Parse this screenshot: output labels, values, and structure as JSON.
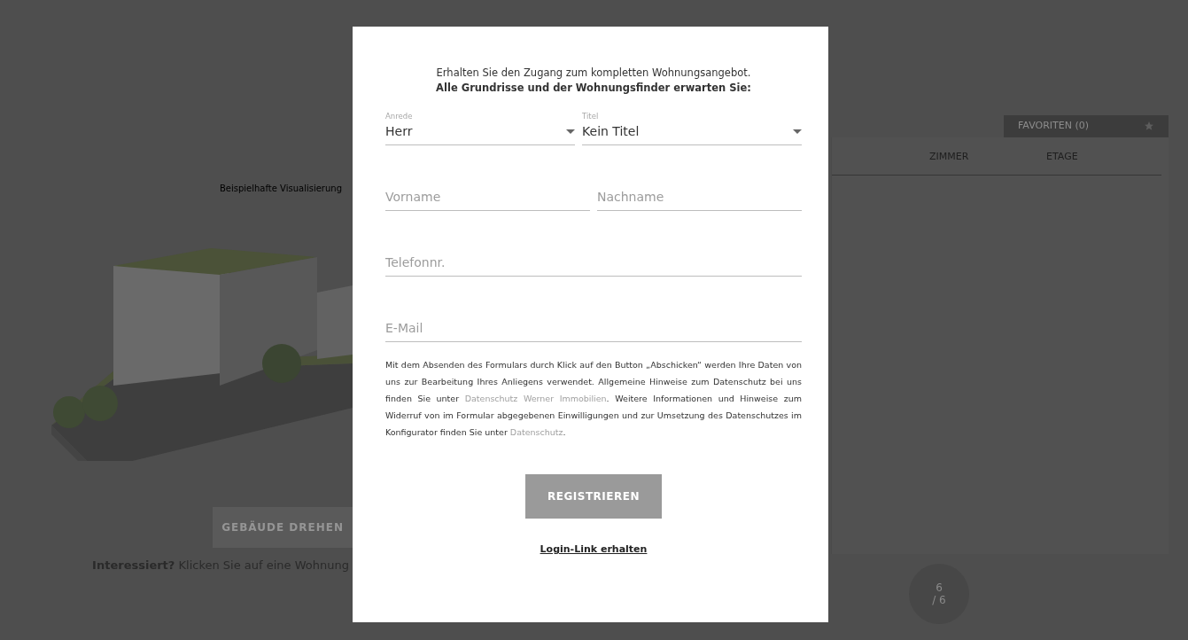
{
  "background": {
    "visual_caption": "Beispielhafte Visualisierung",
    "rotate_button": "GEBÄUDE DREHEN",
    "hint": {
      "lead": "Interessiert?",
      "text": "Klicken Sie auf eine Wohnung"
    },
    "favorites_tab": "FAVORITEN (0)",
    "table": {
      "columns": [
        "ZIMMER",
        "ETAGE"
      ]
    },
    "pager": {
      "current": "6",
      "total": "/ 6"
    }
  },
  "dialog": {
    "intro": "Erhalten Sie den Zugang zum kompletten Wohnungsangebot.",
    "intro_bold": "Alle Grundrisse und der Wohnungsfinder erwarten Sie:",
    "selects": [
      {
        "label": "Anrede",
        "value": "Herr"
      },
      {
        "label": "Titel",
        "value": "Kein Titel"
      }
    ],
    "name_fields": [
      {
        "placeholder": "Vorname"
      },
      {
        "placeholder": "Nachname"
      }
    ],
    "fields": [
      {
        "placeholder": "Telefonnr."
      },
      {
        "placeholder": "E-Mail"
      }
    ],
    "privacy": [
      {
        "kind": "text",
        "text": "Mit dem Absenden des Formulars durch Klick auf den Button „Abschicken“ werden Ihre Daten von uns zur Bearbeitung Ihres Anliegens verwendet. Allgemeine Hinweise zum Datenschutz bei uns finden Sie unter "
      },
      {
        "kind": "link",
        "text": "Datenschutz Werner Immobilien"
      },
      {
        "kind": "text",
        "text": ". Weitere Informationen und Hinweise zum Widerruf von im Formular abgegebenen Einwilligungen und zur Umsetzung des Datenschutzes im Konfigurator finden Sie unter "
      },
      {
        "kind": "link",
        "text": "Datenschutz"
      },
      {
        "kind": "text",
        "text": "."
      }
    ],
    "submit": "REGISTRIEREN",
    "login_link": "Login-Link erhalten"
  }
}
